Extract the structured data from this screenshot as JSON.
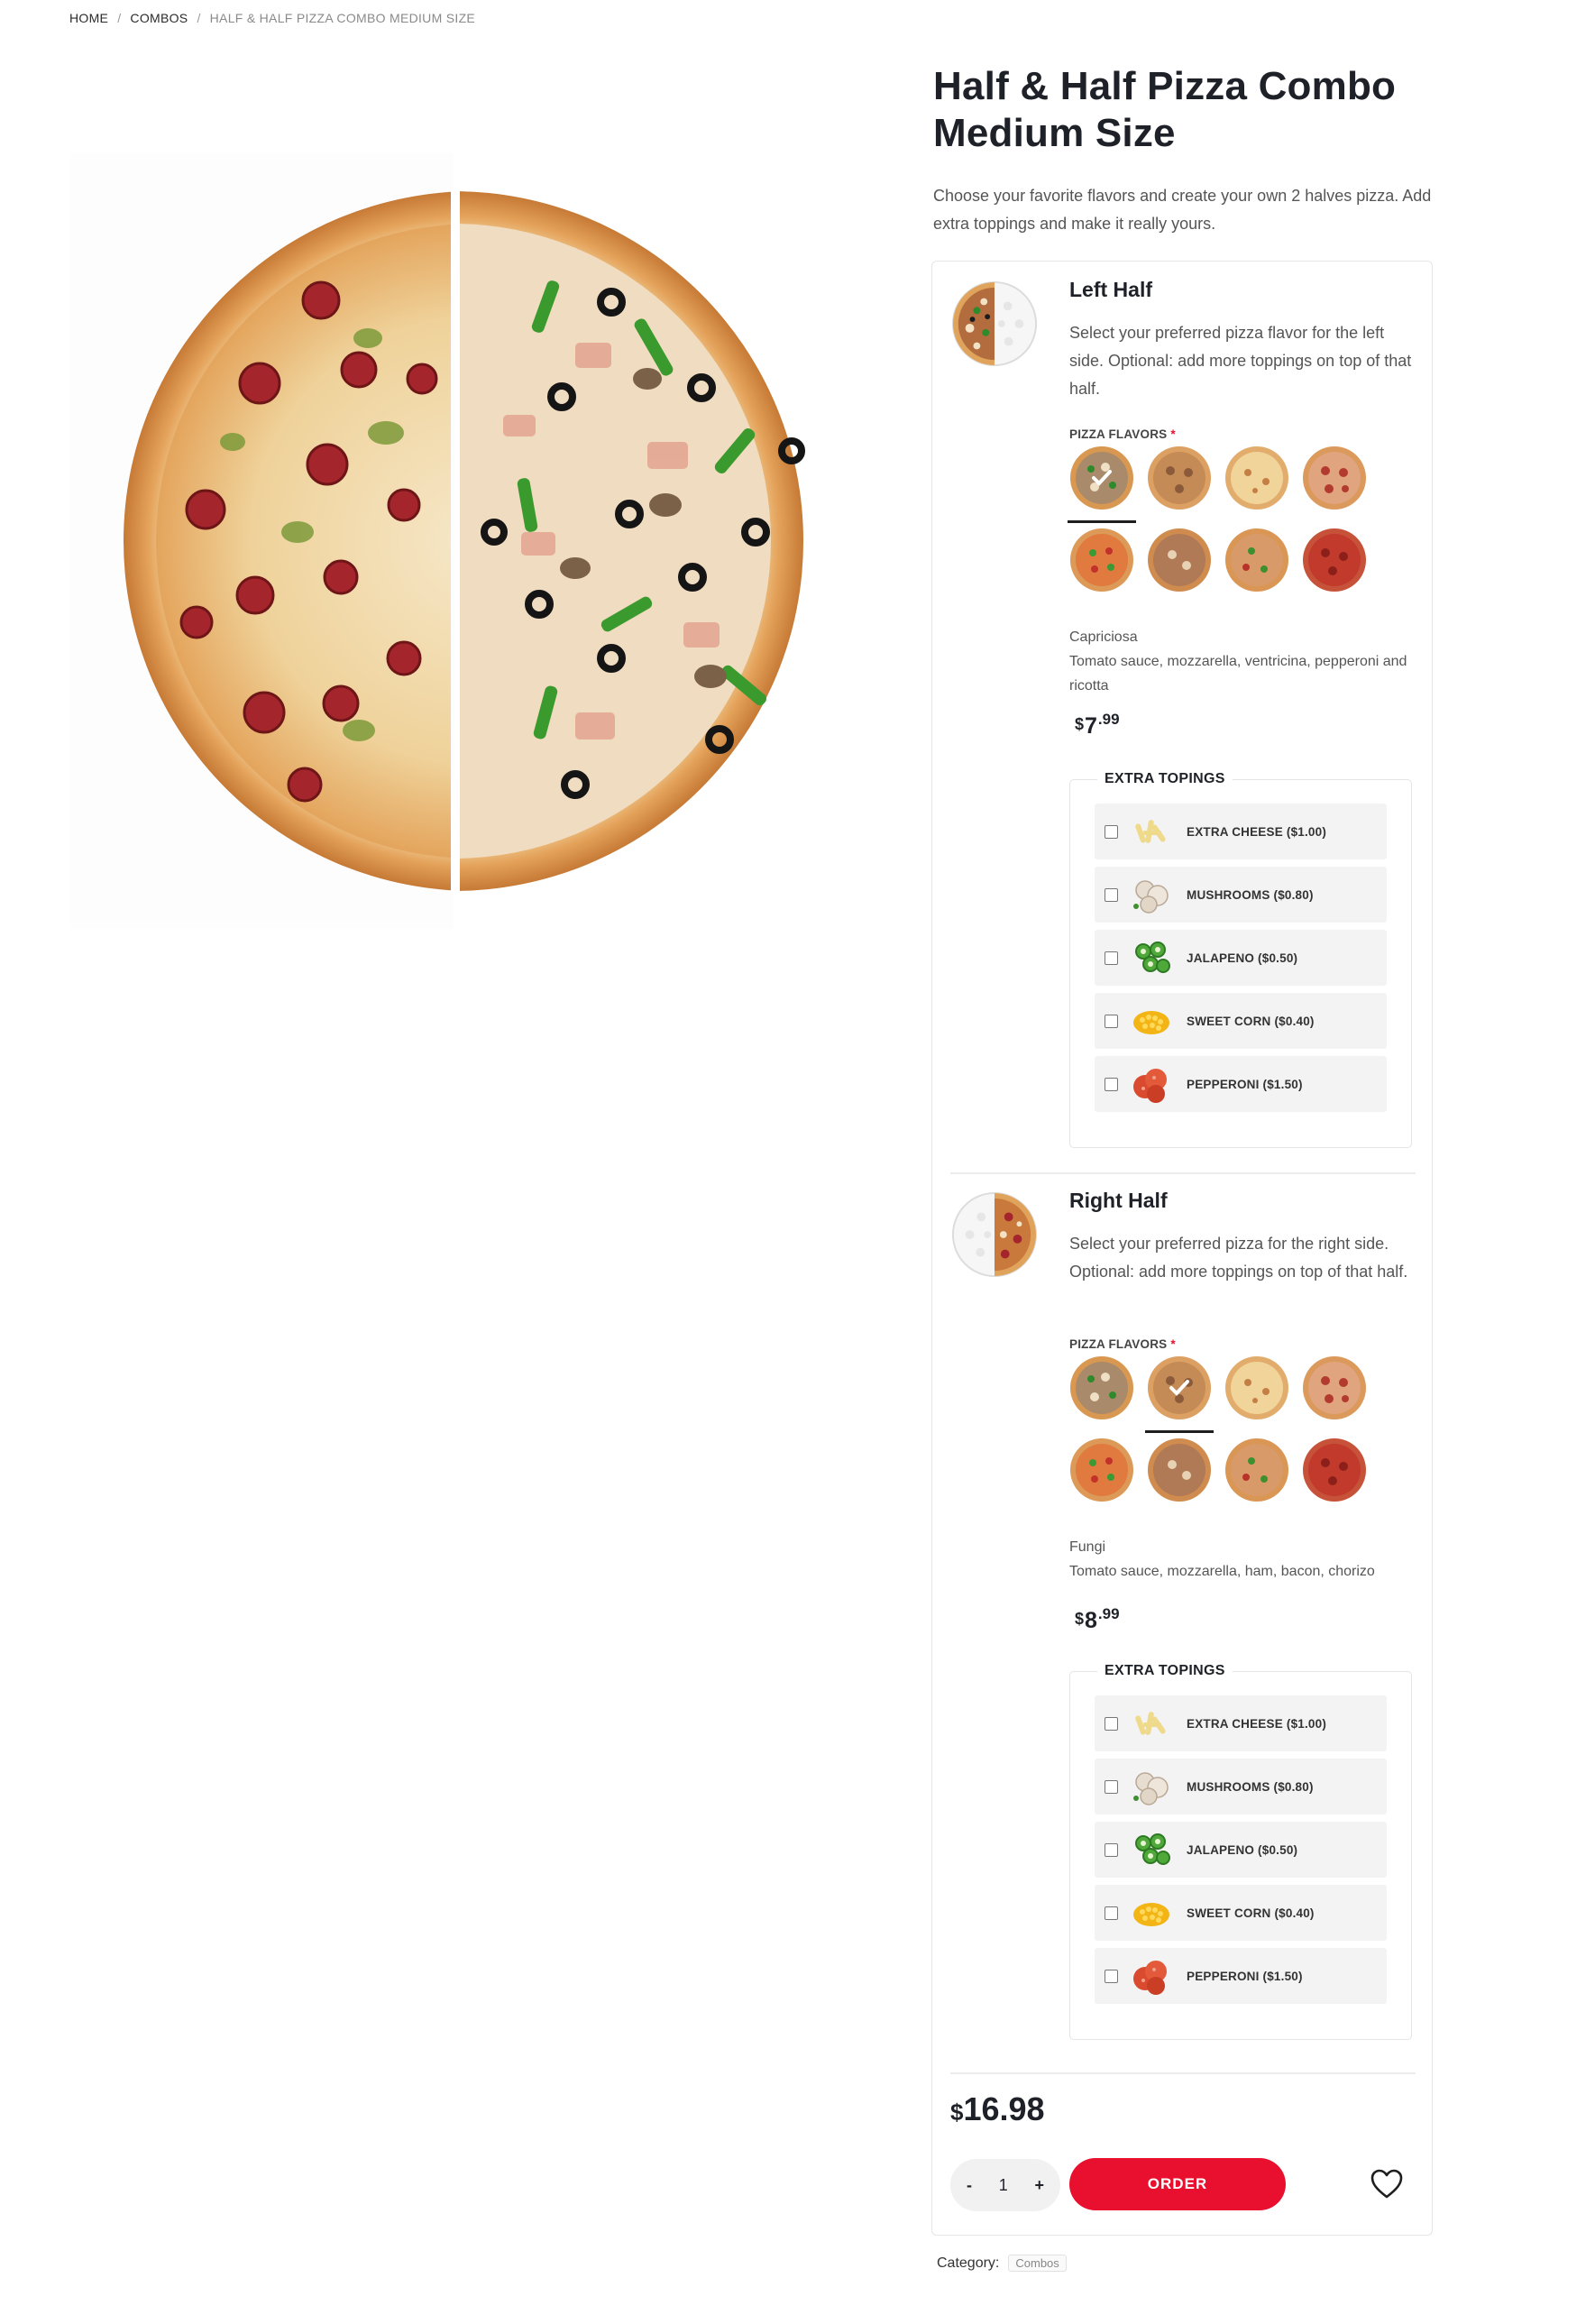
{
  "breadcrumb": {
    "home": "HOME",
    "sep1": "/",
    "combos": "COMBOS",
    "sep2": "/",
    "current": "HALF & HALF PIZZA COMBO MEDIUM SIZE"
  },
  "product": {
    "title": "Half & Half Pizza Combo Medium Size",
    "description": "Choose your favorite flavors and create your own 2 halves pizza. Add extra toppings and make it really yours."
  },
  "flavors_label": "PIZZA FLAVORS",
  "required_mark": "*",
  "extra_toppings_title": "EXTRA TOPINGS",
  "toppings": [
    {
      "label": "EXTRA CHEESE ($1.00)",
      "icon": "cheese-icon"
    },
    {
      "label": "MUSHROOMS ($0.80)",
      "icon": "mushroom-icon"
    },
    {
      "label": "JALAPENO ($0.50)",
      "icon": "jalapeno-icon"
    },
    {
      "label": "SWEET CORN ($0.40)",
      "icon": "corn-icon"
    },
    {
      "label": "PEPPERONI ($1.50)",
      "icon": "pepperoni-icon"
    }
  ],
  "left_half": {
    "title": "Left Half",
    "description": "Select your preferred pizza flavor for the left side. Optional: add more toppings on top of that half.",
    "selected_flavor_index": 0,
    "selected_name": "Capriciosa",
    "selected_ingredients": "Tomato sauce, mozzarella, ventricina, pepperoni and ricotta",
    "price_currency": "$",
    "price_main": "7",
    "price_cents": ".99"
  },
  "right_half": {
    "title": "Right Half",
    "description": "Select your preferred pizza for the right side. Optional: add more toppings on top of that half.",
    "selected_flavor_index": 1,
    "selected_name": "Fungi",
    "selected_ingredients": "Tomato sauce, mozzarella, ham, bacon, chorizo",
    "price_currency": "$",
    "price_main": "8",
    "price_cents": ".99"
  },
  "total": {
    "currency": "$",
    "amount": "16.98"
  },
  "quantity": {
    "minus": "-",
    "value": "1",
    "plus": "+"
  },
  "order_button": "ORDER",
  "category": {
    "label": "Category:",
    "tag": "Combos"
  },
  "colors": {
    "accent": "#e8102e",
    "text": "#1e2228",
    "muted": "#555555",
    "panel": "#f3f3f3"
  }
}
